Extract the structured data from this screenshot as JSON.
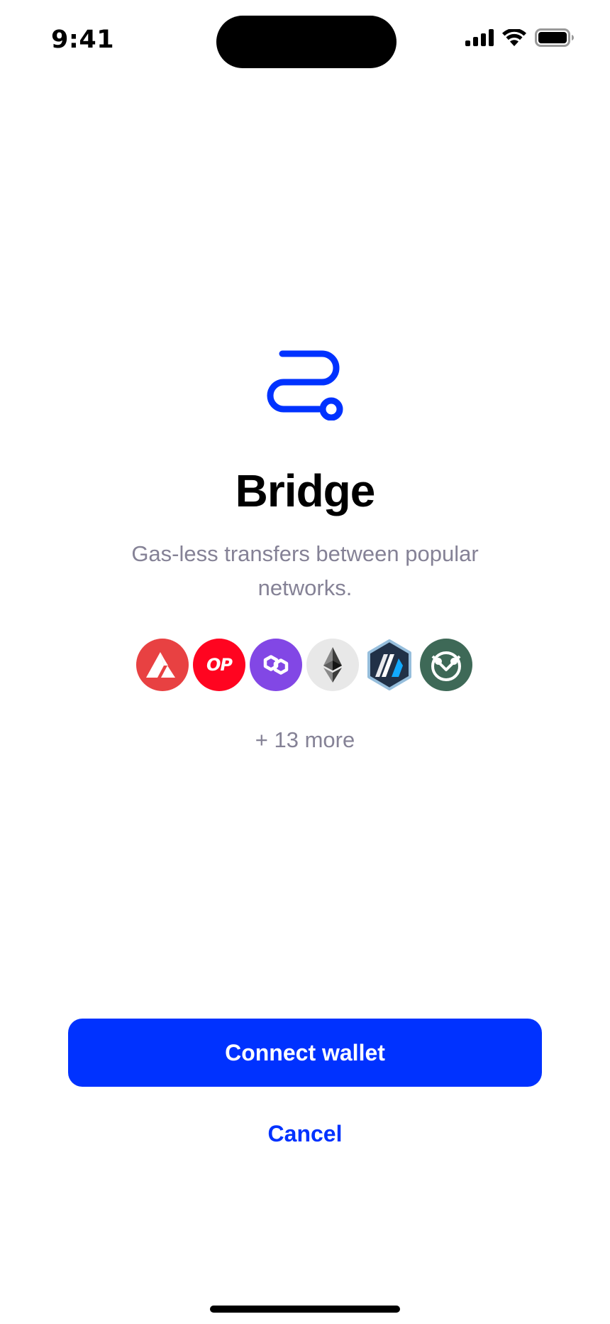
{
  "status_bar": {
    "time": "9:41",
    "icons": [
      "cellular-signal-icon",
      "wifi-icon",
      "battery-icon"
    ]
  },
  "main": {
    "icon": "bridge-route-icon",
    "title": "Bridge",
    "subtitle": "Gas-less transfers between popular networks.",
    "networks": [
      {
        "name": "Avalanche",
        "icon": "avalanche-icon",
        "color": "#e84142"
      },
      {
        "name": "Optimism",
        "icon": "optimism-icon",
        "color": "#ff0420",
        "label": "OP"
      },
      {
        "name": "Polygon",
        "icon": "polygon-icon",
        "color": "#8247e5"
      },
      {
        "name": "Ethereum",
        "icon": "ethereum-icon",
        "color": "#e8e8e8"
      },
      {
        "name": "Arbitrum",
        "icon": "arbitrum-icon",
        "color": "#213147"
      },
      {
        "name": "Gnosis",
        "icon": "gnosis-icon",
        "color": "#3e6957"
      }
    ],
    "more_label": "+ 13 more"
  },
  "actions": {
    "connect_label": "Connect wallet",
    "cancel_label": "Cancel"
  },
  "colors": {
    "accent": "#0032ff",
    "muted_text": "#858296"
  }
}
